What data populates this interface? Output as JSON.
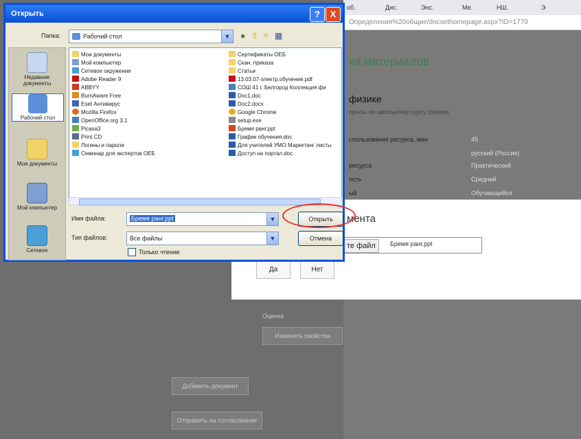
{
  "browser": {
    "tabs": [
      "об.",
      "Дис.",
      "Энс.",
      "Ме.",
      "НШ.",
      "Э"
    ],
    "address": "Определения%20общие/docsethomepage.aspx?ID=1770"
  },
  "background_page": {
    "heading": "ка материалов",
    "subheading": "физике",
    "desc": "просы по школьному курсу физики",
    "props": [
      {
        "label": "спользования ресурса, мин",
        "value": "45"
      },
      {
        "label": "",
        "value": "русский (Россия)"
      },
      {
        "label": "ресурса",
        "value": "Практический"
      },
      {
        "label": "ость",
        "value": "Средний"
      },
      {
        "label": "ый",
        "value": "Обучающийся"
      }
    ],
    "modal_title": "мента",
    "file_button": "те файл",
    "file_name": "Бремя ранг.ppt",
    "yes": "Да",
    "no": "Нет",
    "grade_label": "Оценка",
    "change_props": "Изменить свойства",
    "add_document": "Добавить документ",
    "send_approval": "Отправить на согласование"
  },
  "dialog": {
    "title": "Открыть",
    "help": "?",
    "close": "X",
    "folder_label": "Папка:",
    "folder_value": "Рабочий стол",
    "places": [
      "Недавние документы",
      "Рабочий стол",
      "Мои документы",
      "Мой компьютер",
      "Сетевое"
    ],
    "files_left": [
      "Мои документы",
      "Мой компьютер",
      "Сетевое окружение",
      "Adobe Reader 9",
      "ABBYY",
      "BurnAware Free",
      "Eset Антивирус",
      "Mozilla Firefox",
      "OpenOffice.org 3.1",
      "Picasa3",
      "Print CD",
      "Логины и пароли",
      "Семинар для экспертов ОЕБ"
    ],
    "files_right": [
      "Сертификаты ОЕБ",
      "Скан. приказа",
      "Статьи",
      "13.03.07-электр.обучение.pdf",
      "СОШ 41 г. Белгород Коллекция фи",
      "Doc1.doc",
      "Doc2.docx",
      "Google Chrome",
      "setup.exe",
      "Бремя ранг.ppt",
      "График обучения.doc",
      "Для учителей УМО Маркетинг листы",
      "Доступ на портал.doc"
    ],
    "filename_label": "Имя файла:",
    "filename_value": "Бремя ранг.ppt",
    "filetype_label": "Тип файлов:",
    "filetype_value": "Все файлы",
    "readonly_label": "Только чтение",
    "open_button": "Открыть",
    "cancel_button": "Отмена"
  },
  "colors": {
    "accent": "#0052e0",
    "highlight": "#e53030",
    "green_heading": "#3f7e54"
  }
}
